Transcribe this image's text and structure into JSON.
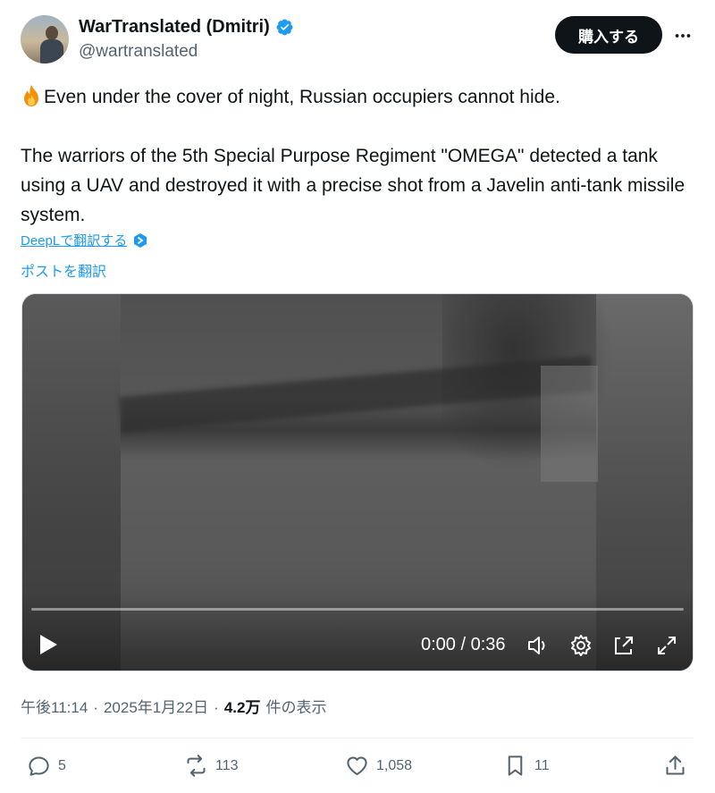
{
  "author": {
    "display_name": "WarTranslated (Dmitri)",
    "handle": "@wartranslated",
    "verified": true
  },
  "buy_button_label": "購入する",
  "tweet": {
    "line1": "Even under the cover of night, Russian occupiers cannot hide.",
    "line2": "The warriors of the 5th Special Purpose Regiment \"OMEGA\" detected a tank using a UAV and destroyed it with a precise shot from a Javelin anti-tank missile system.",
    "emoji_icon": "fire-icon"
  },
  "deepl_link": "DeepLで翻訳する",
  "translate_link": "ポストを翻訳",
  "video": {
    "time": "0:00 / 0:36",
    "progress": 0
  },
  "meta": {
    "time": "午後11:14",
    "separator": "·",
    "date": "2025年1月22日",
    "views": "4.2万",
    "views_label": "件の表示"
  },
  "actions": {
    "replies": "5",
    "reposts": "113",
    "likes": "1,058",
    "bookmarks": "11"
  },
  "colors": {
    "accent": "#1d9bf0",
    "text": "#0f1419",
    "muted": "#536471"
  }
}
